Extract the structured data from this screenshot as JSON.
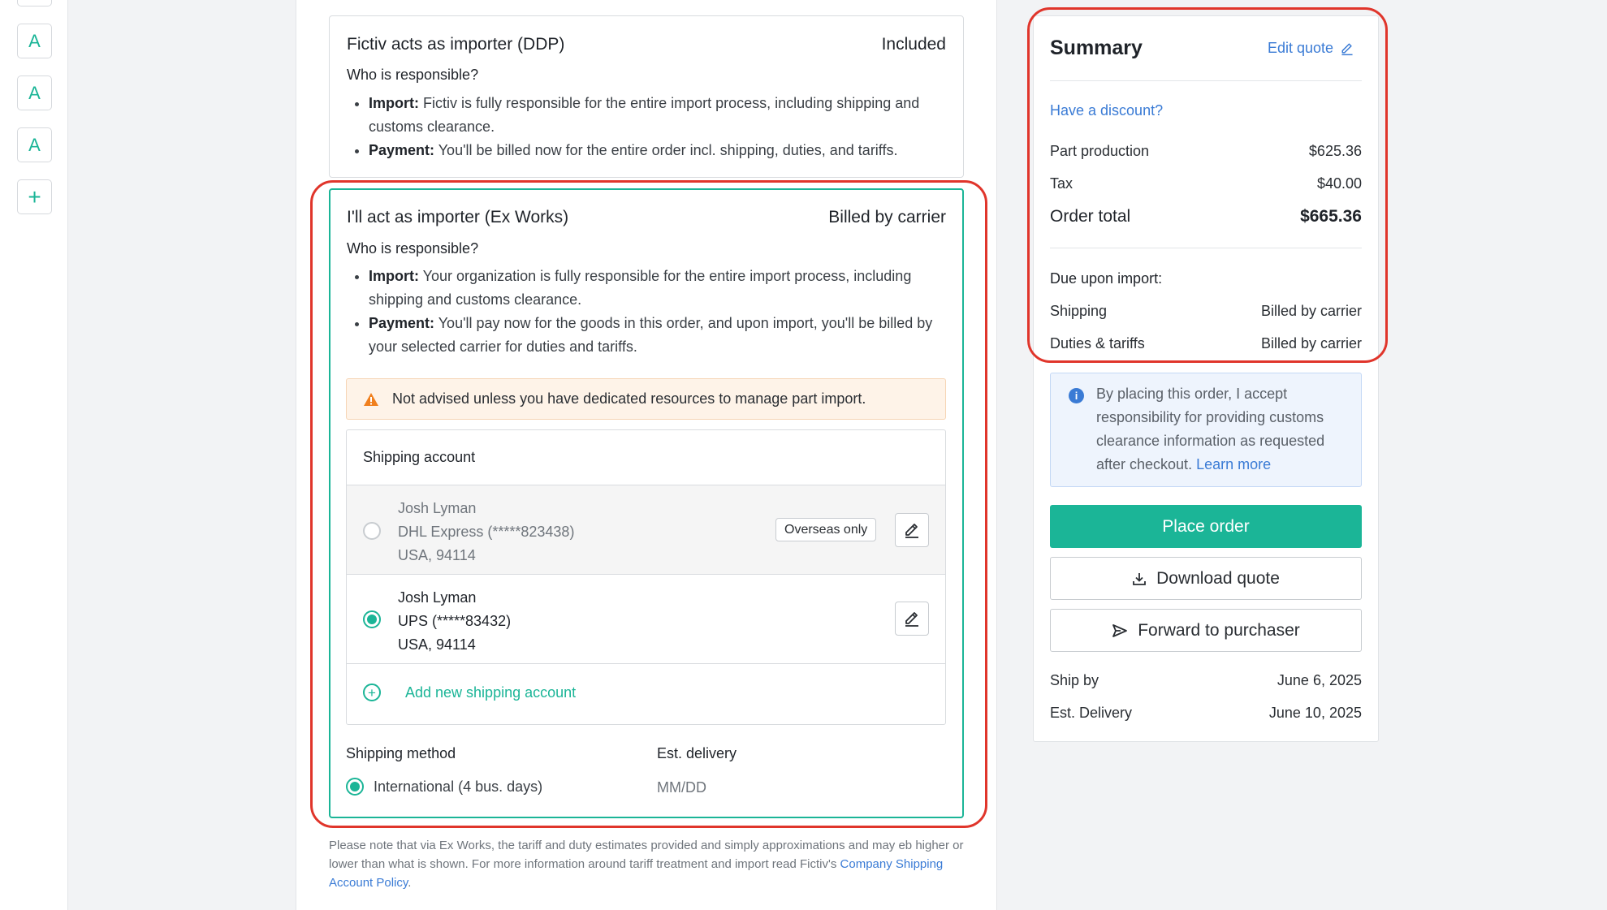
{
  "sidebar": {
    "buttons": [
      "A",
      "A",
      "A",
      "+"
    ]
  },
  "ddp": {
    "title": "Fictiv acts as importer (DDP)",
    "status": "Included",
    "responsible_label": "Who is responsible?",
    "import_label": "Import:",
    "import_text": " Fictiv is fully responsible for the entire import process, including shipping and customs clearance.",
    "payment_label": "Payment:",
    "payment_text": " You'll be billed now for the entire order incl. shipping, duties, and tariffs."
  },
  "exworks": {
    "title": "I'll act as importer (Ex Works)",
    "status": "Billed by carrier",
    "responsible_label": "Who is responsible?",
    "import_label": "Import:",
    "import_text": " Your organization is fully responsible for the entire import process, including shipping and customs clearance.",
    "payment_label": "Payment:",
    "payment_text": " You'll pay now for the goods in this order, and upon import, you'll be billed by your selected carrier for duties and tariffs.",
    "warning": "Not advised unless you have dedicated resources to manage part import.",
    "shipping_account_label": "Shipping account",
    "accounts": [
      {
        "name": "Josh Lyman",
        "carrier": "DHL Express (*****823438)",
        "location": "USA, 94114",
        "badge": "Overseas only",
        "selected": false
      },
      {
        "name": "Josh Lyman",
        "carrier": "UPS (*****83432)",
        "location": "USA, 94114",
        "selected": true
      }
    ],
    "add_account": "Add new shipping account",
    "shipping_method_label": "Shipping method",
    "shipping_method_value": "International (4 bus. days)",
    "est_delivery_label": "Est. delivery",
    "est_delivery_value": "MM/DD"
  },
  "footnote": {
    "text": "Please note that via Ex Works, the tariff and duty estimates provided and simply approximations and may eb higher or lower than what is shown. For more information around tariff treatment and import read Fictiv's ",
    "link": "Company Shipping Account Policy",
    "end": "."
  },
  "summary": {
    "title": "Summary",
    "edit_quote": "Edit quote",
    "discount_link": "Have a discount?",
    "part_production_label": "Part production",
    "part_production_value": "$625.36",
    "tax_label": "Tax",
    "tax_value": "$40.00",
    "order_total_label": "Order total",
    "order_total_value": "$665.36",
    "due_upon_import": "Due upon import:",
    "shipping_label": "Shipping",
    "shipping_value": "Billed by carrier",
    "duties_label": "Duties & tariffs",
    "duties_value": "Billed by carrier",
    "info_text": "By placing this order, I accept responsibility for providing customs clearance information as requested after checkout. ",
    "learn_more": "Learn more",
    "place_order": "Place order",
    "download_quote": "Download quote",
    "forward": "Forward to purchaser",
    "ship_by_label": "Ship by",
    "ship_by_value": "June 6, 2025",
    "delivery_label": "Est. Delivery",
    "delivery_value": "June 10, 2025"
  },
  "colors": {
    "accent": "#1bb597",
    "link": "#3a7bd5",
    "annotation": "#e0352b",
    "warning_bg": "#fef3e8"
  }
}
